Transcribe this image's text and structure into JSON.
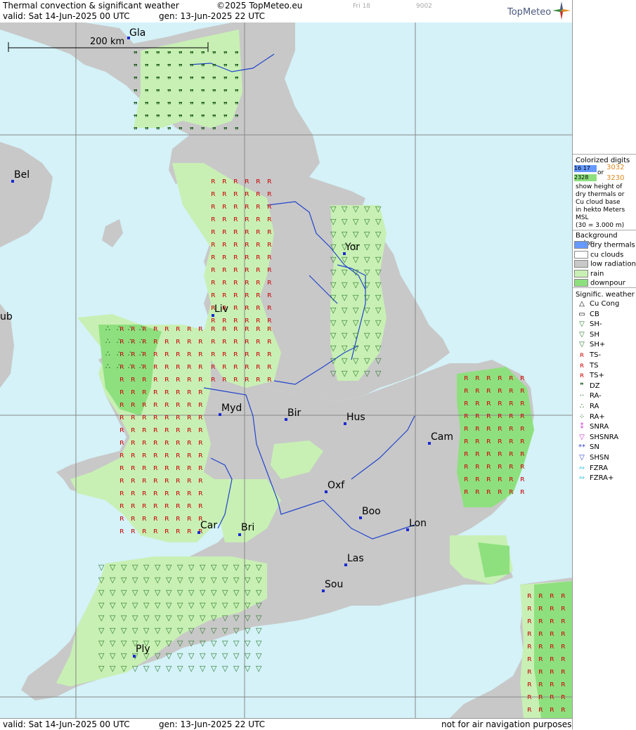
{
  "header": {
    "title": "Thermal convection & significant weather",
    "copyright": "©2025 TopMeteo.eu",
    "valid": "valid:  Sat  14-Jun-2025  00 UTC",
    "gen": "gen: 13-Jun-2025 22 UTC",
    "day_tab": "Fri 18",
    "code": "9002",
    "logo": "TopMeteo"
  },
  "footer": {
    "valid": "valid:  Sat  14-Jun-2025  00 UTC",
    "gen": "gen: 13-Jun-2025 22 UTC",
    "disclaimer": "not for air navigation purposes"
  },
  "scale": {
    "label": "200 km"
  },
  "cities": [
    {
      "name": "Gla"
    },
    {
      "name": "Bel"
    },
    {
      "name": "ub"
    },
    {
      "name": "Yor"
    },
    {
      "name": "Liv"
    },
    {
      "name": "Myd"
    },
    {
      "name": "Bir"
    },
    {
      "name": "Hus"
    },
    {
      "name": "Cam"
    },
    {
      "name": "Oxf"
    },
    {
      "name": "Boo"
    },
    {
      "name": "Lon"
    },
    {
      "name": "Car"
    },
    {
      "name": "Bri"
    },
    {
      "name": "Las"
    },
    {
      "name": "Sou"
    },
    {
      "name": "Ply"
    }
  ],
  "legend": {
    "digits_title_1": "Colorized digits",
    "digits_blue_a": "16  17",
    "digits_or": "or",
    "digits_orange_a": "3032",
    "digits_green_a": "2328",
    "digits_orange_b": "3230",
    "digits_desc_1": "show height of",
    "digits_desc_2": "dry thermals or",
    "digits_desc_3": "Cu cloud base",
    "digits_desc_4": "in hekto Meters",
    "digits_desc_5": "MSL",
    "digits_desc_6": "(30 = 3.000 m)",
    "bg_title": "Background color",
    "bg_items": [
      {
        "label": "dry thermals",
        "color": "#6699ff"
      },
      {
        "label": "cu clouds",
        "color": "#ffffff"
      },
      {
        "label": "low radiation",
        "color": "#c8c8c8"
      },
      {
        "label": "rain",
        "color": "#c8f0b4"
      },
      {
        "label": "downpour",
        "color": "#8ee07e"
      }
    ],
    "wx_title": "Signific. weather",
    "wx_items": [
      {
        "label": "Cu Cong",
        "icon": "cu-cong-icon",
        "glyph": "△",
        "color": "#000000"
      },
      {
        "label": "CB",
        "icon": "cb-icon",
        "glyph": "▭",
        "color": "#000000"
      },
      {
        "label": "SH-",
        "icon": "shower-light-icon",
        "glyph": "▽",
        "color": "#2a7a2a"
      },
      {
        "label": "SH",
        "icon": "shower-icon",
        "glyph": "▽",
        "color": "#2a7a2a"
      },
      {
        "label": "SH+",
        "icon": "shower-heavy-icon",
        "glyph": "▽",
        "color": "#2a7a2a"
      },
      {
        "label": "TS-",
        "icon": "thunderstorm-light-icon",
        "glyph": "ʀ",
        "color": "#cc1111"
      },
      {
        "label": "TS",
        "icon": "thunderstorm-icon",
        "glyph": "ʀ",
        "color": "#cc1111"
      },
      {
        "label": "TS+",
        "icon": "thunderstorm-heavy-icon",
        "glyph": "ʀ",
        "color": "#cc1111"
      },
      {
        "label": "DZ",
        "icon": "drizzle-icon",
        "glyph": "❞",
        "color": "#1a5a1a"
      },
      {
        "label": "RA-",
        "icon": "rain-light-icon",
        "glyph": "··",
        "color": "#1a5a1a"
      },
      {
        "label": "RA",
        "icon": "rain-icon",
        "glyph": "∴",
        "color": "#1a5a1a"
      },
      {
        "label": "RA+",
        "icon": "rain-heavy-icon",
        "glyph": "⁘",
        "color": "#1a5a1a"
      },
      {
        "label": "SNRA",
        "icon": "snow-rain-icon",
        "glyph": "⁑",
        "color": "#cc33cc"
      },
      {
        "label": "SHSNRA",
        "icon": "snow-rain-shower-icon",
        "glyph": "▽",
        "color": "#cc33cc"
      },
      {
        "label": "SN",
        "icon": "snow-icon",
        "glyph": "**",
        "color": "#3344cc"
      },
      {
        "label": "SHSN",
        "icon": "snow-shower-icon",
        "glyph": "▽",
        "color": "#3344cc"
      },
      {
        "label": "FZRA",
        "icon": "freezing-rain-icon",
        "glyph": "∾",
        "color": "#22bbdd"
      },
      {
        "label": "FZRA+",
        "icon": "freezing-rain-heavy-icon",
        "glyph": "∾",
        "color": "#22bbdd"
      }
    ]
  },
  "colors": {
    "sea": "#d4f2f8",
    "land": "#c8c8c8",
    "rain": "#c8f0b4",
    "downpour": "#8ee07e",
    "river": "#2244cc",
    "city_dot": "#1a2ad0"
  }
}
